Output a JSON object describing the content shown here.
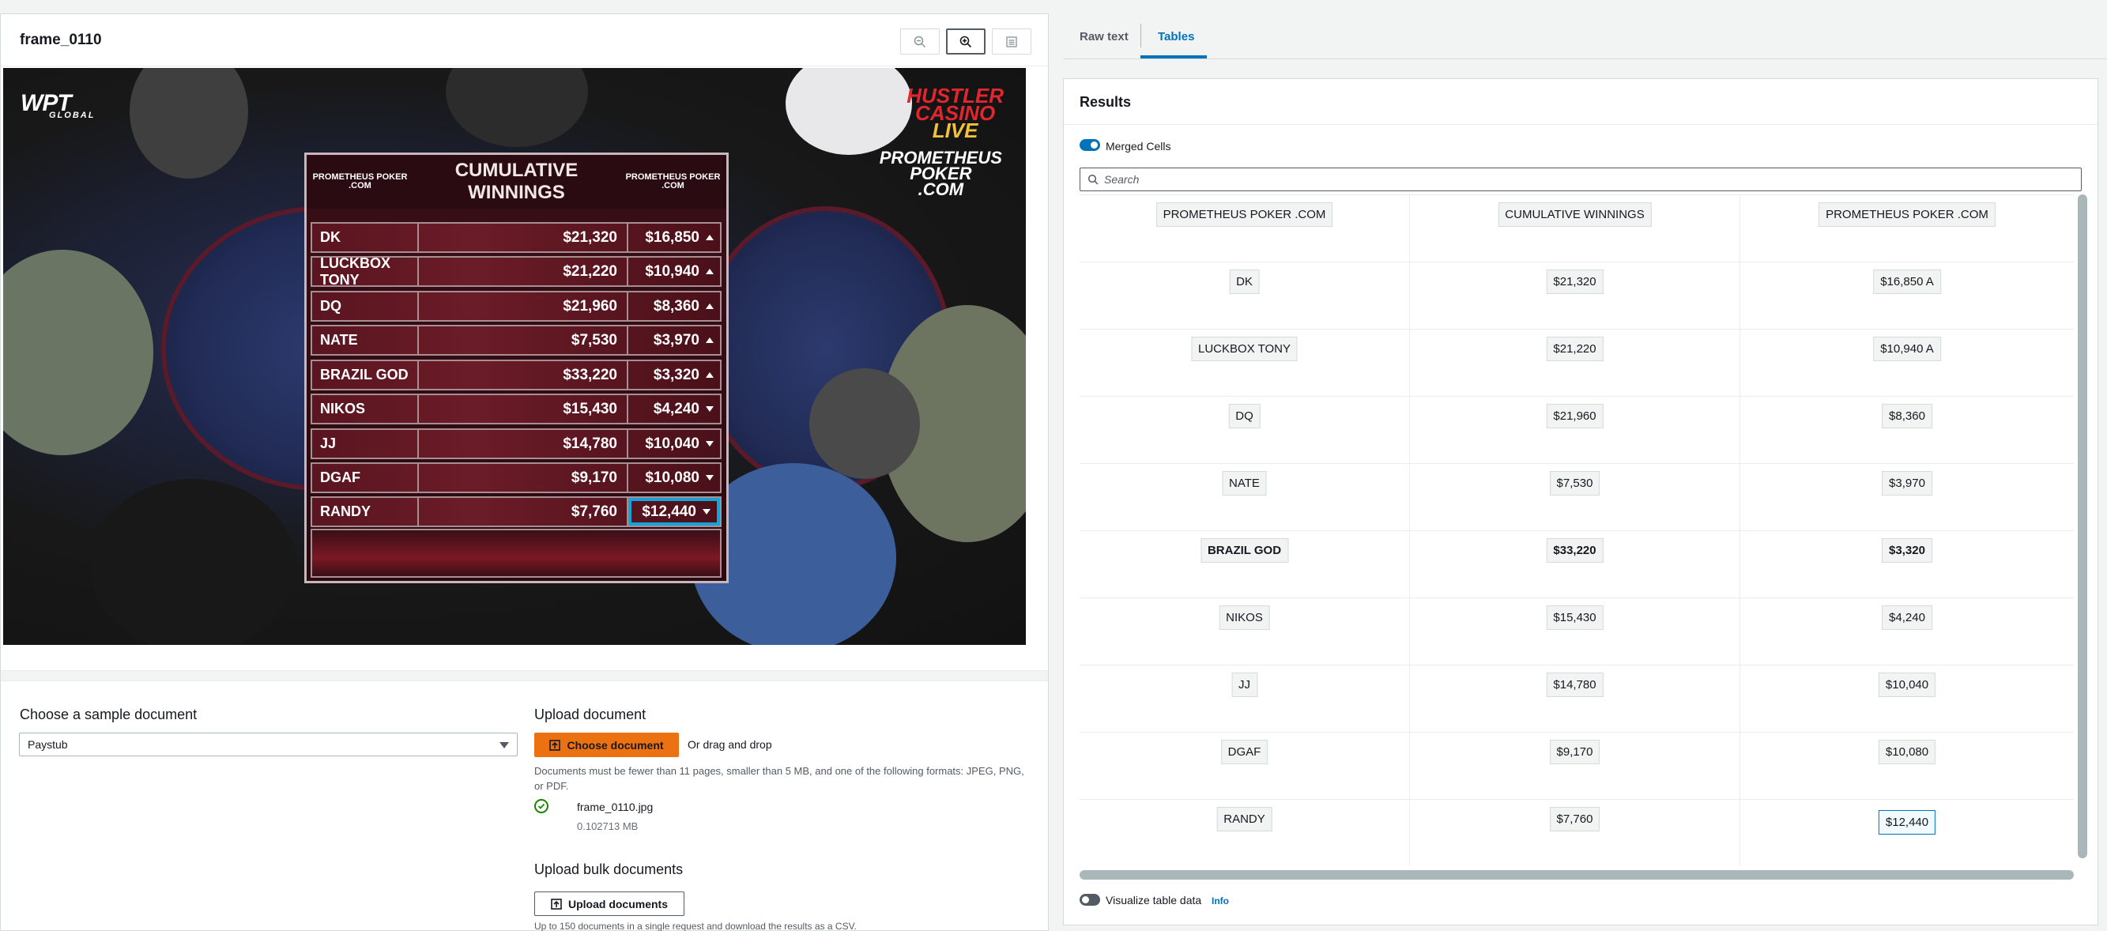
{
  "viewer": {
    "doc_title": "frame_0110",
    "zoom_out_icon": "zoom-out-icon",
    "zoom_in_icon": "zoom-in-icon",
    "list_icon": "list-icon"
  },
  "image": {
    "wpt_logo": "WPT",
    "wpt_logo_sub": "GLOBAL",
    "hcl_logo_line1": "HUSTLER",
    "hcl_logo_line2": "CASINO",
    "hcl_logo_line3": "LIVE",
    "pp_logo_line1": "PROMETHEUS",
    "pp_logo_line2": "POKER",
    "pp_logo_line3": ".COM",
    "board_title": "CUMULATIVE WINNINGS",
    "board_logo_left": "PROMETHEUS POKER .COM",
    "board_logo_right": "PROMETHEUS POKER .COM",
    "rows": [
      {
        "name": "DK",
        "total": "$21,320",
        "session": "$16,850",
        "trend": "up"
      },
      {
        "name": "LUCKBOX TONY",
        "total": "$21,220",
        "session": "$10,940",
        "trend": "up"
      },
      {
        "name": "DQ",
        "total": "$21,960",
        "session": "$8,360",
        "trend": "up"
      },
      {
        "name": "NATE",
        "total": "$7,530",
        "session": "$3,970",
        "trend": "up"
      },
      {
        "name": "BRAZIL GOD",
        "total": "$33,220",
        "session": "$3,320",
        "trend": "up"
      },
      {
        "name": "NIKOS",
        "total": "$15,430",
        "session": "$4,240",
        "trend": "down"
      },
      {
        "name": "JJ",
        "total": "$14,780",
        "session": "$10,040",
        "trend": "down"
      },
      {
        "name": "DGAF",
        "total": "$9,170",
        "session": "$10,080",
        "trend": "down"
      },
      {
        "name": "RANDY",
        "total": "$7,760",
        "session": "$12,440",
        "trend": "down"
      }
    ]
  },
  "sample": {
    "label": "Choose a sample document",
    "selected": "Paystub"
  },
  "upload": {
    "label": "Upload document",
    "button": "Choose document",
    "or_drag": "Or drag and drop",
    "help": "Documents must be fewer than 11 pages, smaller than 5 MB, and one of the following formats: JPEG, PNG, or PDF.",
    "file_name": "frame_0110.jpg",
    "file_size": "0.102713 MB"
  },
  "bulk": {
    "label": "Upload bulk documents",
    "button": "Upload documents",
    "help": "Up to 150 documents in a single request and download the results as a CSV."
  },
  "tabs": {
    "raw_text": "Raw text",
    "tables": "Tables"
  },
  "results": {
    "title": "Results",
    "merged_cells": "Merged Cells",
    "search_placeholder": "Search",
    "visualize": "Visualize table data",
    "info": "Info",
    "header": [
      "PROMETHEUS POKER .COM",
      "CUMULATIVE WINNINGS",
      "PROMETHEUS POKER .COM"
    ],
    "rows": [
      [
        "DK",
        "$21,320",
        "$16,850 A"
      ],
      [
        "LUCKBOX TONY",
        "$21,220",
        "$10,940 A"
      ],
      [
        "DQ",
        "$21,960",
        "$8,360"
      ],
      [
        "NATE",
        "$7,530",
        "$3,970"
      ],
      [
        "BRAZIL GOD",
        "$33,220",
        "$3,320"
      ],
      [
        "NIKOS",
        "$15,430",
        "$4,240"
      ],
      [
        "JJ",
        "$14,780",
        "$10,040"
      ],
      [
        "DGAF",
        "$9,170",
        "$10,080"
      ],
      [
        "RANDY",
        "$7,760",
        "$12,440"
      ]
    ]
  },
  "colors": {
    "accent": "#0073bb",
    "primary_button": "#ec7211",
    "success": "#1d8102"
  }
}
